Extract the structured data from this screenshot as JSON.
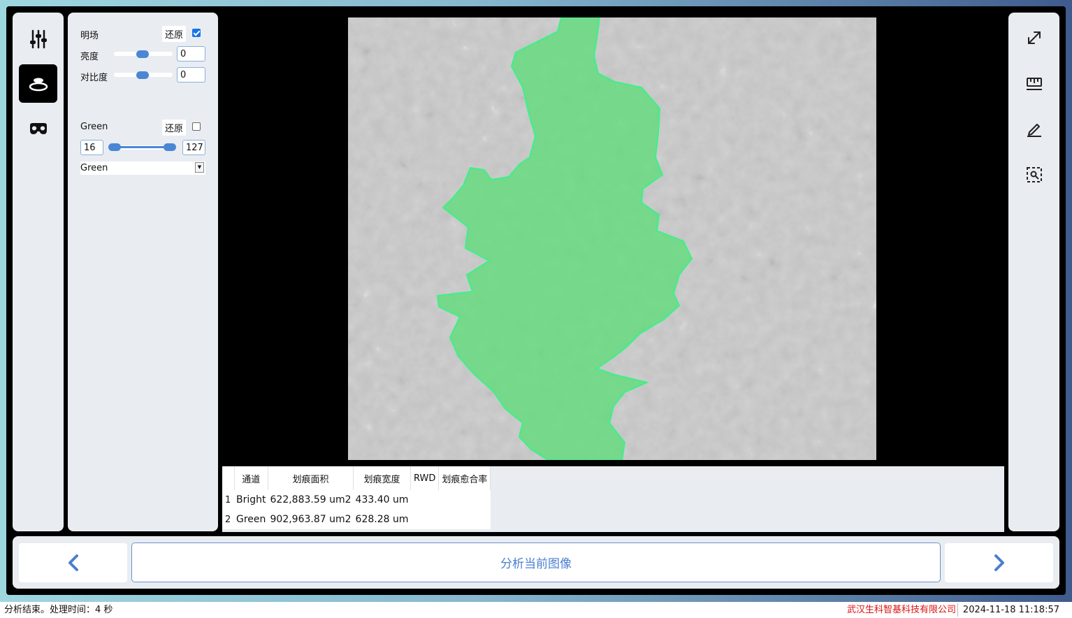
{
  "left_rail": {
    "items": [
      {
        "icon": "sliders-icon",
        "active": false
      },
      {
        "icon": "disc-stack-icon",
        "active": true
      },
      {
        "icon": "mask-icon",
        "active": false
      }
    ]
  },
  "settings": {
    "brightfield": {
      "label": "明场",
      "reset_label": "还原",
      "reset_checked": true,
      "brightness_label": "亮度",
      "brightness_value": "0",
      "contrast_label": "对比度",
      "contrast_value": "0"
    },
    "green": {
      "label": "Green",
      "reset_label": "还原",
      "reset_checked": false,
      "min_value": "16",
      "max_value": "127",
      "color_select": "Green"
    }
  },
  "right_rail": {
    "items": [
      "fullscreen-icon",
      "ruler-icon",
      "pencil-icon",
      "region-select-icon"
    ]
  },
  "results_table": {
    "headers": [
      "通道",
      "划痕面积",
      "划痕宽度",
      "RWD",
      "划痕愈合率"
    ],
    "rows": [
      {
        "index": "1",
        "channel": "Bright",
        "area": "622,883.59 um2",
        "width": "433.40 um",
        "rwd": "",
        "rate": ""
      },
      {
        "index": "2",
        "channel": "Green",
        "area": "902,963.87 um2",
        "width": "628.28 um",
        "rwd": "",
        "rate": ""
      }
    ]
  },
  "bottom": {
    "analyze_label": "分析当前图像"
  },
  "status": {
    "message": "分析结束。处理时间：4 秒",
    "company": "武汉生科智基科技有限公司",
    "datetime": "2024-11-18 11:18:57"
  },
  "colors": {
    "accent": "#4a86d4",
    "overlay": "#5ddc78",
    "company": "#dd1111"
  }
}
